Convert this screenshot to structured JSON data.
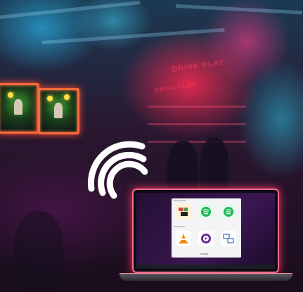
{
  "scene": {
    "sign_text": "DRINK PLAY",
    "sign_text_2": "DRINK PLAY"
  },
  "app_window": {
    "section_top": "Select / Fill URL",
    "section_bottom": "Select a Player",
    "tiles": [
      {
        "name": "media-bundle",
        "color": "#f0a020"
      },
      {
        "name": "spotify",
        "color": "#1db954"
      },
      {
        "name": "spotify",
        "color": "#1db954"
      },
      {
        "name": "vlc",
        "color": "#ff8800"
      },
      {
        "name": "music-player",
        "color": "#6a2b9a"
      },
      {
        "name": "device-mirror",
        "color": "#3a6ec0"
      }
    ],
    "continue_label": "CONTINUE"
  },
  "colors": {
    "neon_pink": "#ff3a6a",
    "neon_orange": "#ff6a3a",
    "wifi": "#ffffff"
  }
}
